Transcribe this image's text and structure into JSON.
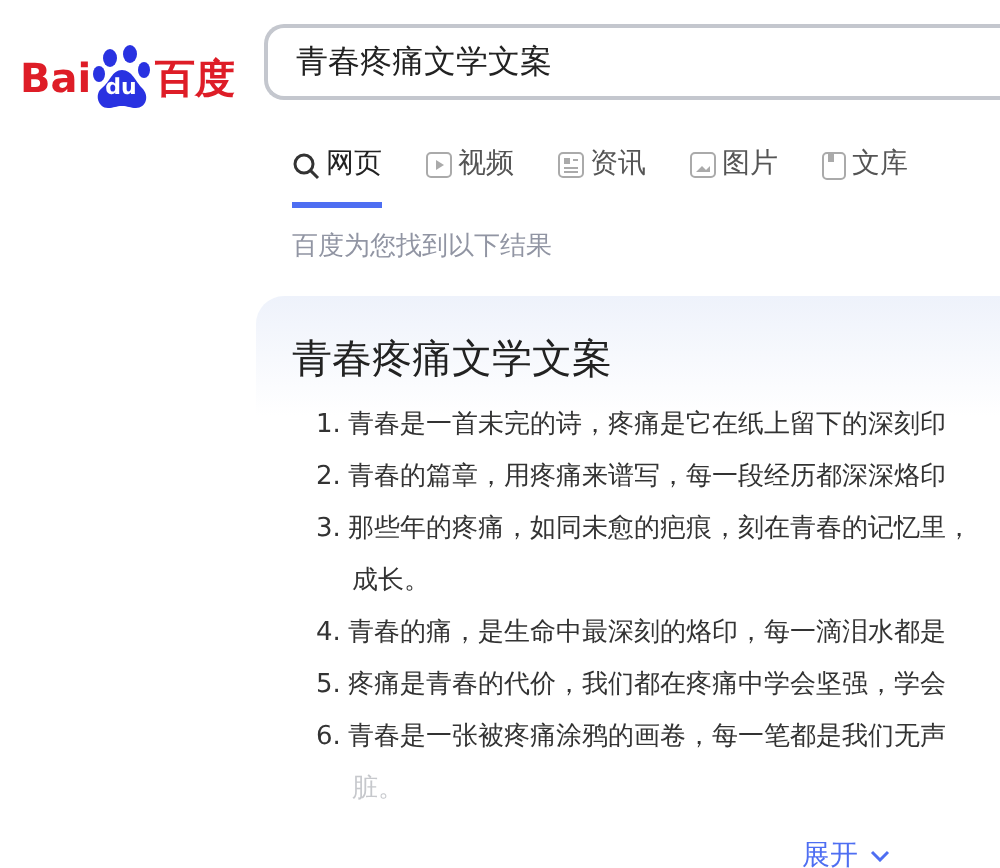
{
  "logo": {
    "left": "Bai",
    "paw": "du",
    "right": "百度"
  },
  "search": {
    "value": "青春疼痛文学文案"
  },
  "tabs": [
    {
      "label": "网页",
      "kind": "search",
      "selected": true
    },
    {
      "label": "视频",
      "kind": "video",
      "selected": false
    },
    {
      "label": "资讯",
      "kind": "news",
      "selected": false
    },
    {
      "label": "图片",
      "kind": "image",
      "selected": false
    },
    {
      "label": "文库",
      "kind": "doc",
      "selected": false
    }
  ],
  "result_count": "百度为您找到以下结果",
  "answer": {
    "title": "青春疼痛文学文案",
    "items": [
      {
        "number": "1.",
        "text": "青春是一首未完的诗，疼痛是它在纸上留下的深刻印"
      },
      {
        "number": "2.",
        "text": "青春的篇章，用疼痛来谱写，每一段经历都深深烙印"
      },
      {
        "number": "3.",
        "text": "那些年的疼痛，如同未愈的疤痕，刻在青春的记忆里，",
        "continuation": "成长。",
        "continuation_faded": false
      },
      {
        "number": "4.",
        "text": "青春的痛，是生命中最深刻的烙印，每一滴泪水都是"
      },
      {
        "number": "5.",
        "text": "疼痛是青春的代价，我们都在疼痛中学会坚强，学会"
      },
      {
        "number": "6.",
        "text": "青春是一张被疼痛涂鸦的画卷，每一笔都是我们无声",
        "continuation": "脏。",
        "continuation_faded": true
      }
    ],
    "expand": "展开"
  }
}
